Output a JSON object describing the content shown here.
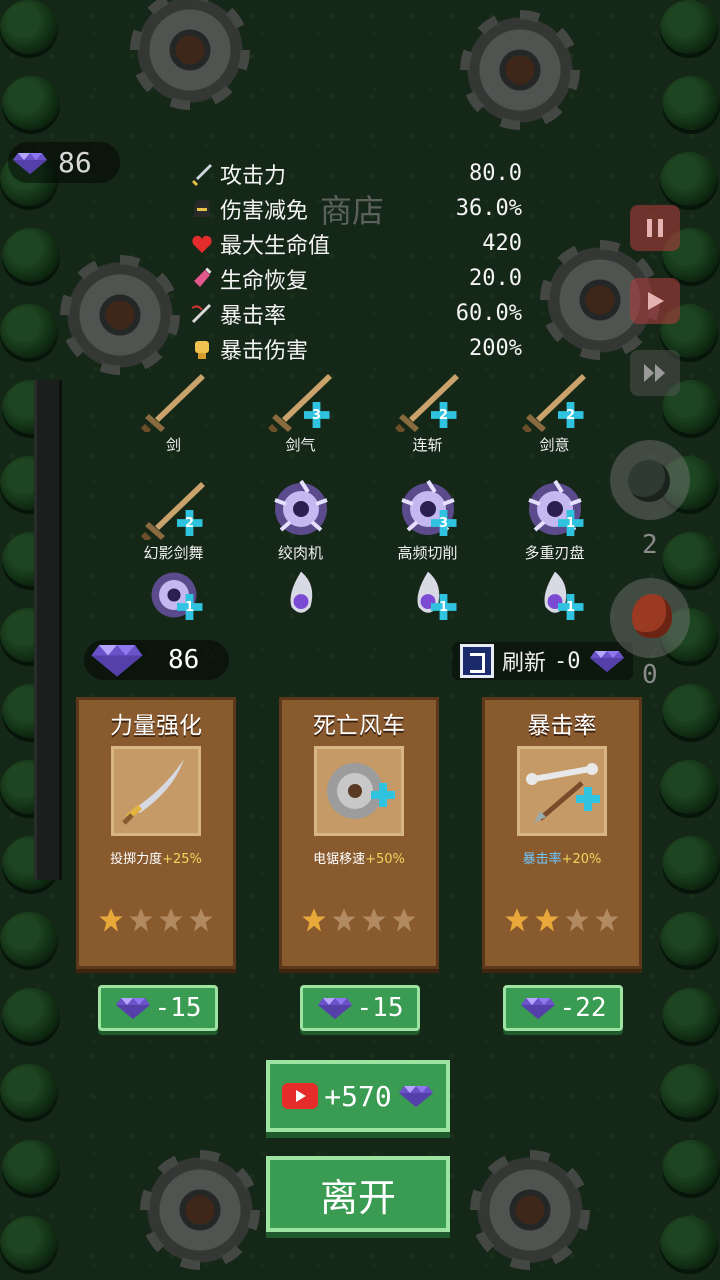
{
  "hud": {
    "gems_top": "86",
    "shop_title": "商店",
    "gems": "86",
    "refresh_label": "刷新",
    "refresh_cost": "-0",
    "bomb_count": "2",
    "meat_count": "0"
  },
  "stats": [
    {
      "icon": "sword-icon",
      "label": "攻击力",
      "value": "80.0"
    },
    {
      "icon": "helmet-icon",
      "label": "伤害减免",
      "value": "36.0%"
    },
    {
      "icon": "heart-icon",
      "label": "最大生命值",
      "value": "420"
    },
    {
      "icon": "potion-icon",
      "label": "生命恢复",
      "value": "20.0"
    },
    {
      "icon": "crit-icon",
      "label": "暴击率",
      "value": "60.0%"
    },
    {
      "icon": "fist-icon",
      "label": "暴击伤害",
      "value": "200%"
    }
  ],
  "skills": [
    {
      "name": "剑",
      "level": "",
      "type": "sword"
    },
    {
      "name": "剑气",
      "level": "3",
      "type": "sword"
    },
    {
      "name": "连斩",
      "level": "2",
      "type": "sword"
    },
    {
      "name": "剑意",
      "level": "2",
      "type": "sword"
    },
    {
      "name": "幻影剑舞",
      "level": "2",
      "type": "sword"
    },
    {
      "name": "绞肉机",
      "level": "",
      "type": "saw"
    },
    {
      "name": "高频切削",
      "level": "3",
      "type": "saw"
    },
    {
      "name": "多重刃盘",
      "level": "1",
      "type": "saw"
    }
  ],
  "passives": [
    {
      "type": "saw",
      "level": "1"
    },
    {
      "type": "orb",
      "level": ""
    },
    {
      "type": "orb",
      "level": "1"
    },
    {
      "type": "orb",
      "level": "1"
    }
  ],
  "cards": [
    {
      "title": "力量强化",
      "desc": "投掷力度",
      "bonus": "+25%",
      "stars": 1,
      "cost": "-15",
      "item": "sword-item-icon",
      "desc_color": "white"
    },
    {
      "title": "死亡风车",
      "desc": "电锯移速",
      "bonus": "+50%",
      "stars": 1,
      "cost": "-15",
      "item": "saw-item-icon",
      "desc_color": "white"
    },
    {
      "title": "暴击率",
      "desc": "暴击率",
      "bonus": "+20%",
      "stars": 2,
      "cost": "-22",
      "item": "arrow-item-icon",
      "desc_color": "blue"
    }
  ],
  "buttons": {
    "ad_reward": "+570",
    "leave": "离开"
  },
  "colors": {
    "button_green": "#3a9b52",
    "card_brown": "#8a5a2f",
    "gem_purple": "#9b7bff",
    "level_badge": "#2fc3e0"
  }
}
